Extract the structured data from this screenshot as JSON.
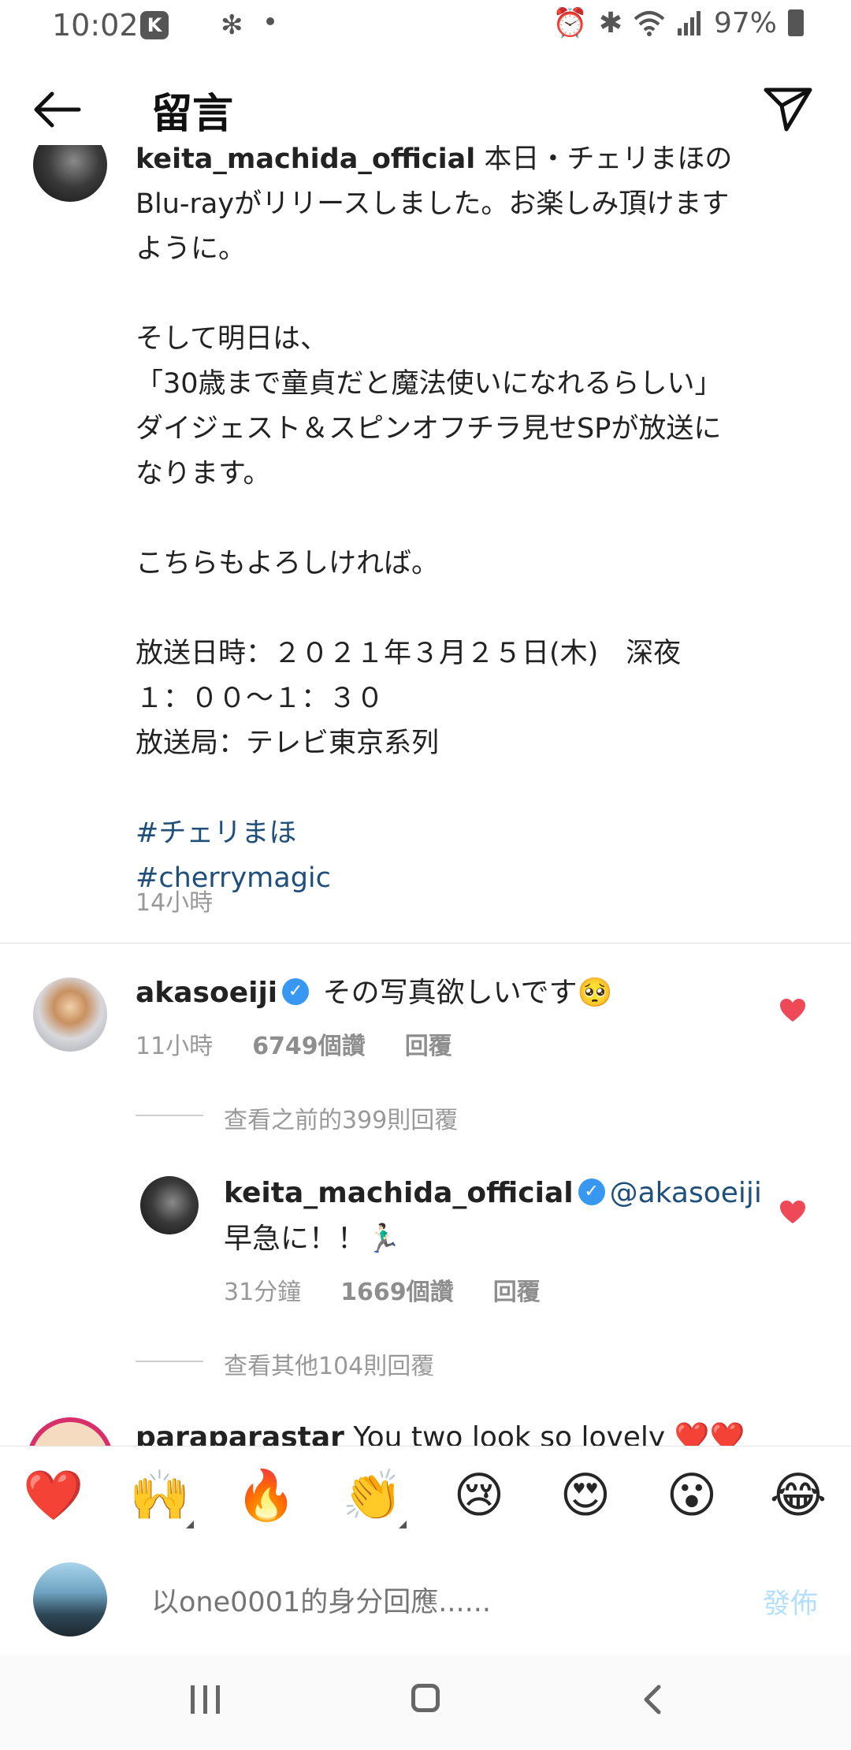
{
  "status_bar": {
    "time": "10:02",
    "k_badge": "K",
    "battery": "97%"
  },
  "header": {
    "title": "留言"
  },
  "caption": {
    "username": "keita_machida_official",
    "text_after_user": " 本日・チェリまほの\nBlu-rayがリリースしました。お楽しみ頂けます\nように。\n\nそして明日は、\n「30歳まで童貞だと魔法使いになれるらしい」\nダイジェスト＆スピンオフチラ見せSPが放送に\nなります。\n\nこちらもよろしければ。\n\n放送日時：２０２１年３月２５日(木)　深夜\n１：００〜１：３０\n放送局：テレビ東京系列\n\n",
    "hashtags": [
      "#チェリまほ",
      "#cherrymagic"
    ],
    "time": "14小時"
  },
  "comments": [
    {
      "username": "akasoeiji",
      "verified": true,
      "text": "その写真欲しいです🥺",
      "time": "11小時",
      "likes": "6749個讚",
      "reply_label": "回覆",
      "view_replies": "查看之前的399則回覆",
      "reply": {
        "username": "keita_machida_official",
        "verified": true,
        "mention": "@akasoeiji",
        "text": "早急に！！🏃🏻‍♂️",
        "time": "31分鐘",
        "likes": "1669個讚",
        "reply_label": "回覆"
      },
      "view_more": "查看其他104則回覆"
    },
    {
      "username": "paraparastar",
      "text": "You two look so lovely ❤️❤️"
    }
  ],
  "emoji_bar": [
    "❤️",
    "🙌",
    "🔥",
    "👏",
    "😢",
    "😍",
    "😮",
    "😂"
  ],
  "input": {
    "placeholder": "以one0001的身分回應......",
    "post_label": "發佈"
  },
  "colors": {
    "heart": "#ed4956",
    "link": "#1f4f7a",
    "verified": "#3897f0",
    "post_disabled": "#b2dffc"
  }
}
